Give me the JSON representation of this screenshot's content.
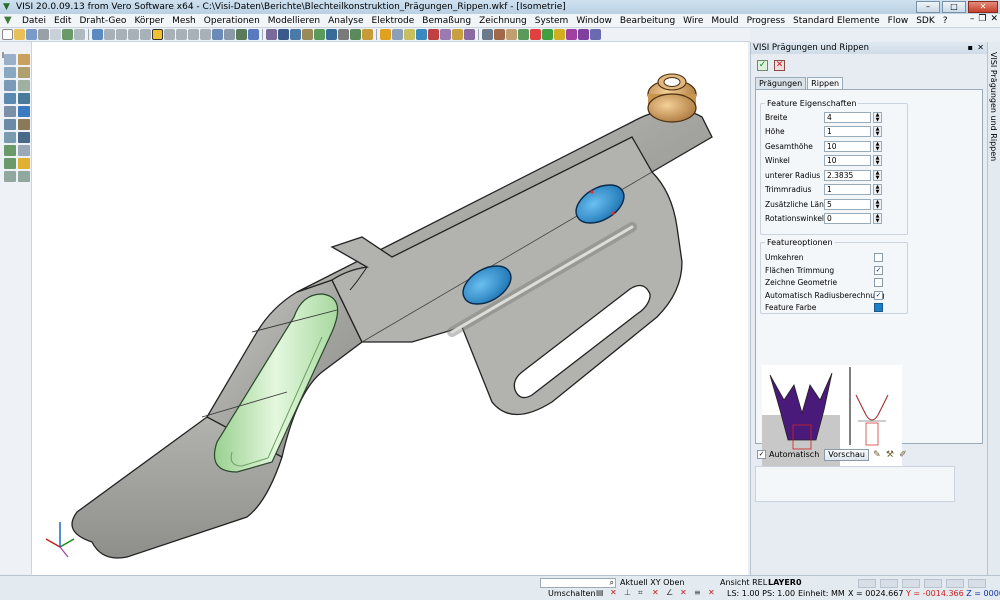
{
  "window": {
    "title": "VISI 20.0.09.13 from Vero Software x64 - C:\\Visi-Daten\\Berichte\\Blechteilkonstruktion_Prägungen_Rippen.wkf - [Isometrie]",
    "minimize": "–",
    "maximize": "□",
    "close": "✕"
  },
  "menu": {
    "items": [
      "Datei",
      "Edit",
      "Draht-Geo",
      "Körper",
      "Mesh",
      "Operationen",
      "Modellieren",
      "Analyse",
      "Elektrode",
      "Bemaßung",
      "Zeichnung",
      "System",
      "Window",
      "Bearbeitung",
      "Wire",
      "Mould",
      "Progress",
      "Standard Elemente",
      "Flow",
      "SDK",
      "?"
    ],
    "mdi_min": "–",
    "mdi_restore": "❐",
    "mdi_close": "✕"
  },
  "panel": {
    "title": "VISI Prägungen und Rippen",
    "pin": "▪",
    "close": "✕",
    "ok": "✓",
    "cancel": "✕",
    "tabs": [
      "Prägungen",
      "Rippen"
    ],
    "active_tab": "Rippen",
    "feature_group_title": "Feature Eigenschaften",
    "properties": [
      {
        "label": "Breite",
        "value": "4"
      },
      {
        "label": "Höhe",
        "value": "1"
      },
      {
        "label": "Gesamthöhe",
        "value": "10"
      },
      {
        "label": "Winkel",
        "value": "10"
      },
      {
        "label": "unterer Radius",
        "value": "2.3835"
      },
      {
        "label": "Trimmradius",
        "value": "1"
      },
      {
        "label": "Zusätzliche Länge",
        "value": "5"
      },
      {
        "label": "Rotationswinkel",
        "value": "0"
      }
    ],
    "options_group_title": "Featureoptionen",
    "options": [
      {
        "label": "Umkehren",
        "checked": false
      },
      {
        "label": "Flächen Trimmung",
        "checked": true
      },
      {
        "label": "Zeichne Geometrie",
        "checked": false
      },
      {
        "label": "Automatisch Radiusberechnung",
        "checked": true
      }
    ],
    "feature_color_label": "Feature Farbe",
    "feature_color": "#1e7fc8",
    "auto_label": "Automatisch",
    "preview_button": "Vorschau",
    "check_mark": "✓",
    "vertical_tab": "VISI Prägungen und Rippen"
  },
  "statusbar": {
    "search_icon": "⌕",
    "aktuell": "Aktuell XY Oben",
    "ansicht": "Ansicht REL",
    "layer": "LAYER0",
    "umschalten": "Umschalten",
    "ls_ps": "LS: 1.00 PS: 1.00",
    "einheit": "Einheit: MM",
    "x": "X = 0024.667",
    "y": "Y = -0014.366",
    "z": "Z = 0000.000"
  },
  "colors": {
    "sheet_metal": "#a9a9a5",
    "rib_blue": "#2a8fd0",
    "emboss_green": "#b8e8b0",
    "bushing": "#d9a86a"
  }
}
